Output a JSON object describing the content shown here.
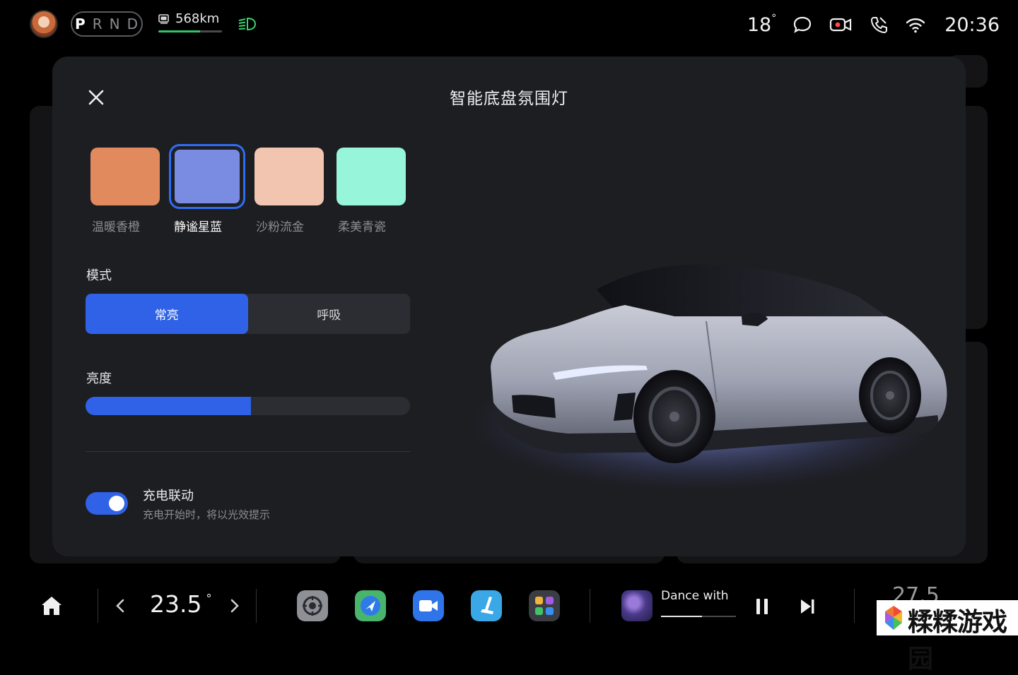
{
  "status_bar": {
    "gears": [
      "P",
      "R",
      "N",
      "D"
    ],
    "active_gear": "P",
    "range": "568km",
    "range_fraction": 0.65,
    "outside_temp": "18",
    "temp_unit": "°",
    "time": "20:36"
  },
  "modal": {
    "title": "智能底盘氛围灯",
    "swatches": [
      {
        "name": "温暖香橙",
        "color": "#e08a5e"
      },
      {
        "name": "静谧星蓝",
        "color": "#7a8be2",
        "selected": true
      },
      {
        "name": "沙粉流金",
        "color": "#f2c5b1"
      },
      {
        "name": "柔美青瓷",
        "color": "#97f5d9"
      }
    ],
    "mode_label": "模式",
    "modes": [
      "常亮",
      "呼吸"
    ],
    "active_mode": "常亮",
    "brightness_label": "亮度",
    "brightness_fraction": 0.51,
    "charge_link": {
      "title": "充电联动",
      "description": "充电开始时，将以光效提示",
      "enabled": true
    }
  },
  "dock": {
    "cabin_temp": "23.5",
    "temp_unit": "°",
    "song_title": "Dance with",
    "song_progress": 0.55,
    "partial_right_temp": "27.5"
  },
  "watermark": {
    "text": "糅糅游戏园"
  },
  "colors": {
    "accent": "#2f62e6",
    "panel": "#1d1e22",
    "track": "#2c2d32",
    "battery": "#33c36a"
  }
}
